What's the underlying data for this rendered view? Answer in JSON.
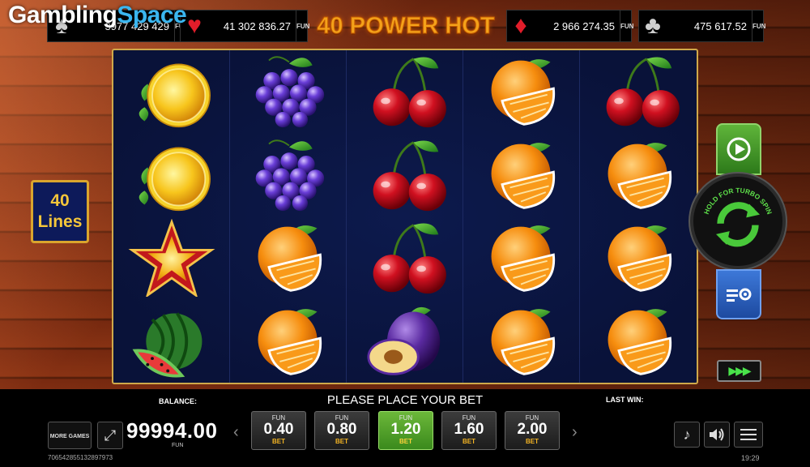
{
  "logo": {
    "part1": "Gambling",
    "part2": "Space"
  },
  "header": {
    "title": "40 POWER HOT",
    "jackpots": [
      {
        "suit": "spade-icon",
        "glyph": "♠",
        "value": "3977 429 429",
        "fun": "FUN",
        "color": "#cfcfcf"
      },
      {
        "suit": "heart-icon",
        "glyph": "♥",
        "value": "41 302 836.27",
        "fun": "FUN",
        "color": "#e11d2a"
      },
      {
        "suit": "diamond-icon",
        "glyph": "♦",
        "value": "2 966 274.35",
        "fun": "FUN",
        "color": "#e11d2a"
      },
      {
        "suit": "club-icon",
        "glyph": "♣",
        "value": "475 617.52",
        "fun": "FUN",
        "color": "#cfcfcf"
      }
    ]
  },
  "lines": {
    "count": "40",
    "label": "Lines"
  },
  "reels": [
    [
      "lemon",
      "lemon",
      "star",
      "watermelon"
    ],
    [
      "grapes",
      "grapes",
      "orange",
      "orange"
    ],
    [
      "cherries",
      "cherries",
      "cherries",
      "plum"
    ],
    [
      "orange",
      "orange",
      "orange",
      "orange"
    ],
    [
      "cherries",
      "orange",
      "orange",
      "orange"
    ]
  ],
  "controls": {
    "spin_label": "HOLD FOR TURBO SPIN",
    "turbo_label": "▶▶▶",
    "more_games": "MORE GAMES",
    "fullscreen_glyph": "⤢"
  },
  "footer": {
    "balance_label": "BALANCE:",
    "balance_value": "99994.00",
    "balance_currency": "FUN",
    "message": "PLEASE PLACE YOUR BET",
    "last_win_label": "LAST WIN:",
    "prev_arrow": "‹",
    "next_arrow": "›",
    "bets": [
      {
        "currency": "FUN",
        "value": "0.40",
        "label": "BET",
        "active": false
      },
      {
        "currency": "FUN",
        "value": "0.80",
        "label": "BET",
        "active": false
      },
      {
        "currency": "FUN",
        "value": "1.20",
        "label": "BET",
        "active": true
      },
      {
        "currency": "FUN",
        "value": "1.60",
        "label": "BET",
        "active": false
      },
      {
        "currency": "FUN",
        "value": "2.00",
        "label": "BET",
        "active": false
      }
    ],
    "music_glyph": "♪",
    "sound_glyph": "🔊",
    "round_id": "706542855132897973",
    "clock": "19:29"
  },
  "colors": {
    "accent_gold": "#f4a21a",
    "active_bet": "#6cb83a",
    "reel_bg": "#0d1a4d"
  }
}
